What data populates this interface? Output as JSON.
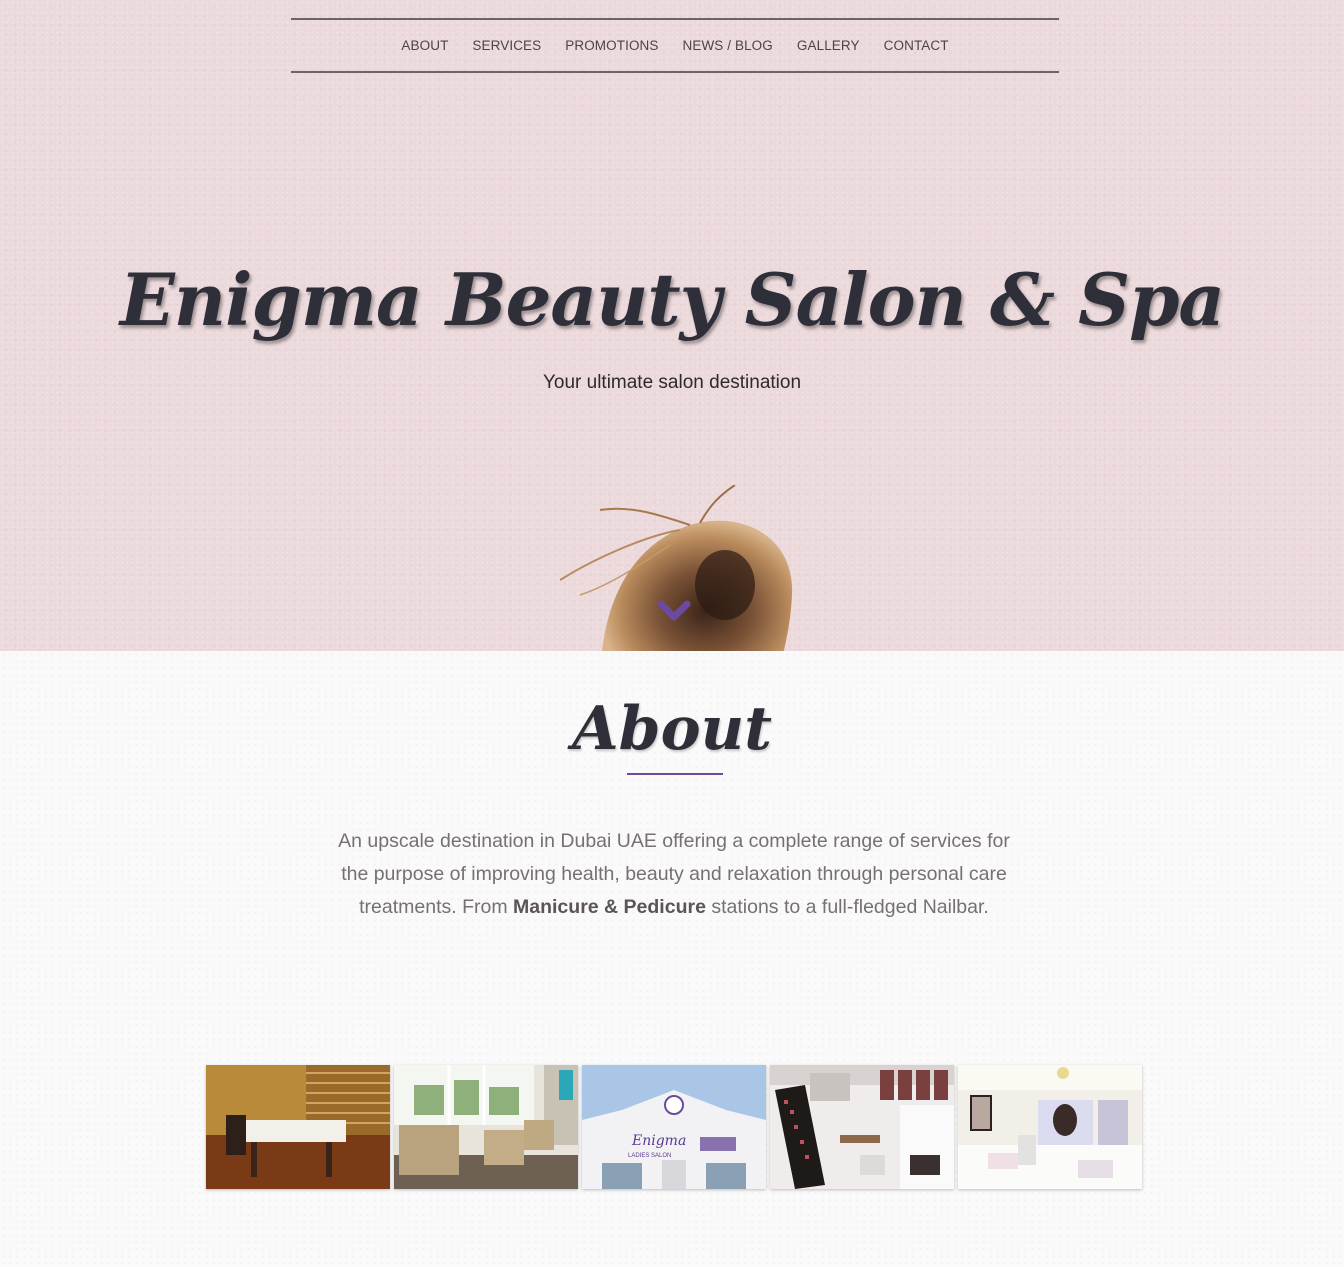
{
  "nav": {
    "items": [
      {
        "label": "ABOUT"
      },
      {
        "label": "SERVICES"
      },
      {
        "label": "PROMOTIONS"
      },
      {
        "label": "NEWS / BLOG"
      },
      {
        "label": "GALLERY"
      },
      {
        "label": "CONTACT"
      }
    ]
  },
  "hero": {
    "title": "Enigma Beauty Salon & Spa",
    "subtitle": "Your ultimate salon destination",
    "background_color": "#ecd9db",
    "scroll_icon": "chevron-down-icon",
    "accent_color": "#6b4aa0"
  },
  "about": {
    "title": "About",
    "text_before": "An upscale destination in Dubai UAE offering a complete range of services for the purpose of improving health, beauty and relaxation through personal care treatments. From ",
    "text_bold": "Manicure & Pedicure",
    "text_after": " stations to a full-fledged Nailbar.",
    "sign_en": "Enigma",
    "sign_sub": "LADIES SALON"
  },
  "gallery": {
    "images": [
      {
        "name": "treatment-room-photo"
      },
      {
        "name": "lounge-chairs-photo"
      },
      {
        "name": "salon-exterior-photo"
      },
      {
        "name": "makeup-station-photo"
      },
      {
        "name": "salon-interior-photo"
      }
    ]
  }
}
